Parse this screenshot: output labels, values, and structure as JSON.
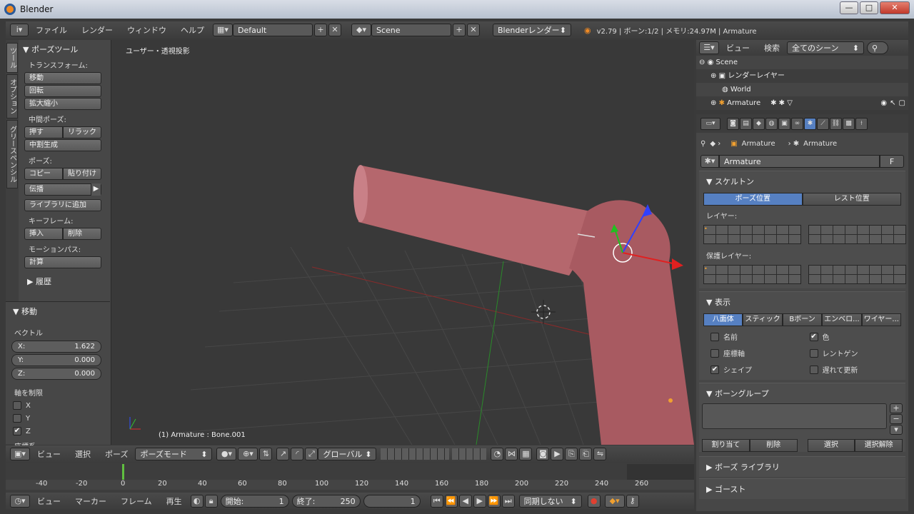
{
  "window": {
    "title": "Blender",
    "min": "—",
    "max": "□",
    "close": "✕"
  },
  "menubar": {
    "info_icon": "info-icon",
    "items": [
      "ファイル",
      "レンダー",
      "ウィンドウ",
      "ヘルプ"
    ],
    "layout": "Default",
    "scene": "Scene",
    "engine": "Blenderレンダー",
    "stats": "v2.79 | ボーン:1/2 | メモリ:24.97M | Armature"
  },
  "toolshelf": {
    "tabs": [
      "ツール",
      "オプション",
      "グリースペンシル"
    ],
    "pose_tools": "▼ ポーズツール",
    "transform_label": "トランスフォーム:",
    "transform_buttons": [
      "移動",
      "回転",
      "拡大縮小"
    ],
    "inbetween_label": "中間ポーズ:",
    "push": "押す",
    "relax": "リラック",
    "breakdown": "中割生成",
    "pose_label": "ポーズ:",
    "copy": "コピー",
    "paste": "貼り付け",
    "propagate": "伝播",
    "add_library": "ライブラリに追加",
    "keyframe_label": "キーフレーム:",
    "insert": "挿入",
    "delete": "削除",
    "motion_label": "モーションパス:",
    "calculate": "計算",
    "history": "▶ 履歴",
    "op_title": "▼ 移動",
    "vector_label": "ベクトル",
    "x": {
      "label": "X:",
      "value": "1.622"
    },
    "y": {
      "label": "Y:",
      "value": "0.000"
    },
    "z": {
      "label": "Z:",
      "value": "0.000"
    },
    "constraint_label": "軸を制限",
    "axes": [
      {
        "label": "X",
        "checked": false
      },
      {
        "label": "Y",
        "checked": false
      },
      {
        "label": "Z",
        "checked": true
      }
    ],
    "coord_label": "座標系"
  },
  "viewport": {
    "view_label": "ユーザー・透視投影",
    "object_label": "(1) Armature : Bone.001"
  },
  "view_header": {
    "menus": [
      "ビュー",
      "選択",
      "ポーズ"
    ],
    "mode": "ポーズモード",
    "orientation": "グローバル"
  },
  "timeline": {
    "ticks": [
      "-40",
      "-20",
      "0",
      "20",
      "40",
      "60",
      "80",
      "100",
      "120",
      "140",
      "160",
      "180",
      "200",
      "220",
      "240",
      "260"
    ]
  },
  "timeline_header": {
    "menus": [
      "ビュー",
      "マーカー",
      "フレーム",
      "再生"
    ],
    "start_label": "開始:",
    "start": "1",
    "end_label": "終了:",
    "end": "250",
    "current": "1",
    "sync": "同期しない"
  },
  "outliner": {
    "menus": [
      "ビュー",
      "検索"
    ],
    "filter": "全てのシーン",
    "items": [
      "Scene",
      "レンダーレイヤー",
      "World",
      "Armature"
    ]
  },
  "properties": {
    "breadcrumb": [
      "Armature",
      "Armature"
    ],
    "datablock": "Armature",
    "fake": "F",
    "skeleton": "▼ スケルトン",
    "pose_position": "ポーズ位置",
    "rest_position": "レスト位置",
    "layers": "レイヤー:",
    "protected_layers": "保護レイヤー:",
    "display": "▼ 表示",
    "display_modes": [
      "八面体",
      "スティック",
      "Bボーン",
      "エンベロ...",
      "ワイヤー..."
    ],
    "options": [
      {
        "label": "名前",
        "checked": false
      },
      {
        "label": "色",
        "checked": true
      },
      {
        "label": "座標軸",
        "checked": false
      },
      {
        "label": "レントゲン",
        "checked": false
      },
      {
        "label": "シェイプ",
        "checked": true
      },
      {
        "label": "遅れて更新",
        "checked": false
      }
    ],
    "bone_groups": "▼ ボーングループ",
    "assign": "割り当て",
    "remove": "削除",
    "select": "選択",
    "deselect": "選択解除",
    "pose_library": "▶ ボーズ ライブラリ",
    "ghost": "▶ ゴースト"
  },
  "colors": {
    "accent": "#5680c2",
    "bone": "#b5676d",
    "grid": "#474747"
  }
}
